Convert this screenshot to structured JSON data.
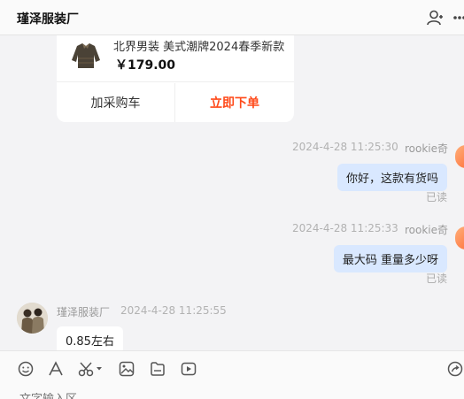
{
  "header": {
    "title": "瑾泽服装厂",
    "add_user_icon": "add-user-icon",
    "more_icon": "more-icon"
  },
  "product_card": {
    "name": "北界男装 美式潮牌2024春季新款",
    "price": "￥179.00",
    "add_cart_label": "加采购车",
    "order_label": "立即下单"
  },
  "messages": [
    {
      "time": "2024-4-28 11:25:30",
      "sender": "rookie奇",
      "text": "你好，这款有货吗",
      "status": "已读"
    },
    {
      "time": "2024-4-28 11:25:33",
      "sender": "rookie奇",
      "text": "最大码  重量多少呀",
      "status": "已读"
    },
    {
      "sender": "瑾泽服装厂",
      "time": "2024-4-28 11:25:55",
      "text": "0.85左右"
    }
  ],
  "toolbar": {
    "icons": [
      "emoji-icon",
      "font-icon",
      "scissors-icon",
      "image-icon",
      "file-icon",
      "video-icon",
      "share-icon"
    ],
    "input_placeholder": "文字输入区"
  },
  "colors": {
    "accent": "#ff4a1a",
    "bubble_out": "#d9e8ff",
    "background": "#f3f3f5"
  }
}
